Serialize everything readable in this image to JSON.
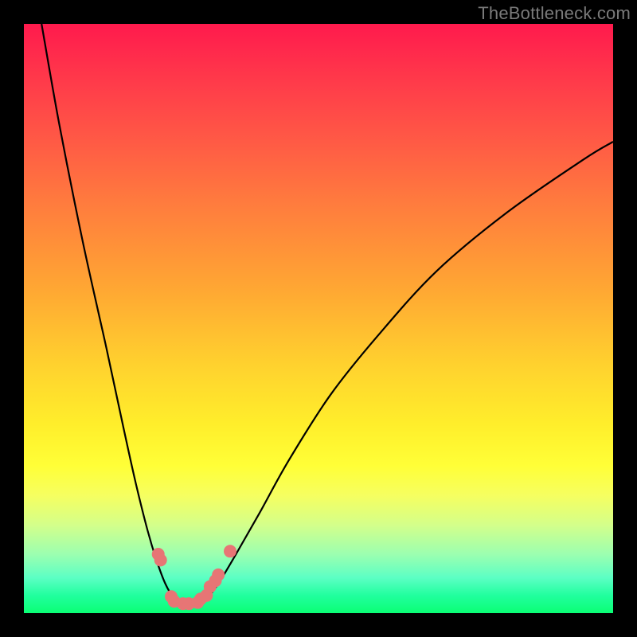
{
  "watermark": "TheBottleneck.com",
  "colors": {
    "background": "#000000",
    "gradient_top": "#ff1a4d",
    "gradient_mid": "#ffd22e",
    "gradient_bottom": "#0aff74",
    "curve": "#000000",
    "dot": "#e77575"
  },
  "chart_data": {
    "type": "line",
    "title": "",
    "xlabel": "",
    "ylabel": "",
    "xlim": [
      0,
      100
    ],
    "ylim": [
      0,
      100
    ],
    "grid": false,
    "legend": false,
    "series": [
      {
        "name": "bottleneck-curve",
        "x": [
          3,
          6,
          10,
          14,
          17,
          19,
          21,
          22.5,
          24,
          25.5,
          27,
          29,
          31,
          33,
          36,
          40,
          45,
          52,
          60,
          70,
          82,
          95,
          100
        ],
        "y": [
          100,
          83,
          63,
          45,
          31,
          22,
          14,
          9,
          5,
          2.5,
          1.5,
          1.5,
          2.5,
          5,
          10,
          17,
          26,
          37,
          47,
          58,
          68,
          77,
          80
        ]
      }
    ],
    "scatter": [
      {
        "x": 22.8,
        "y": 10
      },
      {
        "x": 23.2,
        "y": 9
      },
      {
        "x": 25.0,
        "y": 2.8
      },
      {
        "x": 25.5,
        "y": 2.0
      },
      {
        "x": 27.0,
        "y": 1.6
      },
      {
        "x": 28.0,
        "y": 1.6
      },
      {
        "x": 29.5,
        "y": 1.8
      },
      {
        "x": 30.0,
        "y": 2.4
      },
      {
        "x": 31.0,
        "y": 3.0
      },
      {
        "x": 31.6,
        "y": 4.5
      },
      {
        "x": 32.5,
        "y": 5.5
      },
      {
        "x": 33.0,
        "y": 6.5
      },
      {
        "x": 35.0,
        "y": 10.5
      }
    ]
  }
}
